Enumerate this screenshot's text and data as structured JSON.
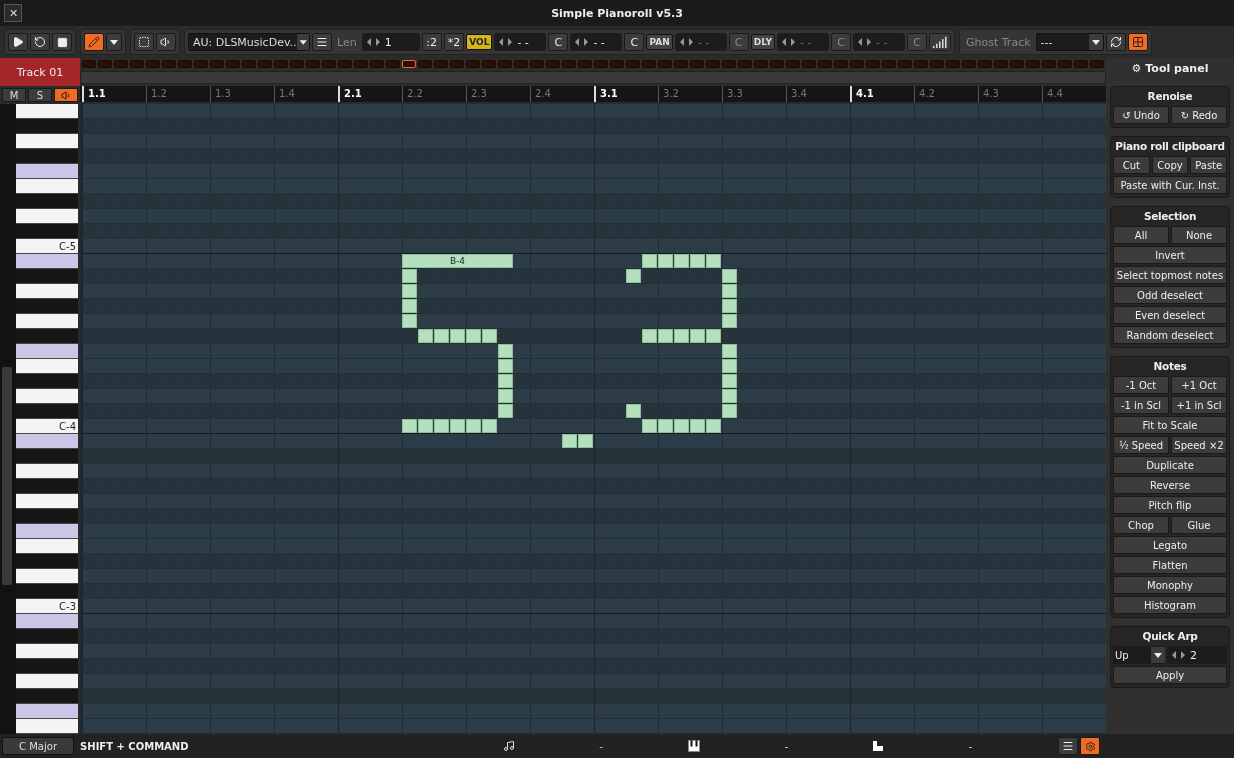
{
  "window": {
    "title": "Simple Pianoroll v5.3",
    "close": "✕"
  },
  "toolbar": {
    "edit_tools": [
      {
        "selected": true
      },
      {
        "selected": false
      }
    ],
    "preview": {
      "on": false
    },
    "instrument": {
      "value": "AU: DLSMusicDev.."
    },
    "length": {
      "label": "Len",
      "value": "1",
      "buttons": [
        ":2",
        "*2"
      ]
    },
    "params": [
      {
        "badge": "VOL",
        "active": true,
        "fields": [
          {
            "value": "- -",
            "reset": "C",
            "disabled": false
          },
          {
            "value": "- -",
            "reset": "C",
            "disabled": false
          }
        ]
      },
      {
        "badge": "PAN",
        "active": false,
        "fields": [
          {
            "value": "- -",
            "reset": "C",
            "disabled": true
          }
        ]
      },
      {
        "badge": "DLY",
        "active": false,
        "fields": [
          {
            "value": "- -",
            "reset": "C",
            "disabled": true
          },
          {
            "value": "- -",
            "reset": "C",
            "disabled": true
          }
        ]
      }
    ],
    "ghost_track": {
      "label": "Ghost Track",
      "value": "---"
    },
    "panel_toggle": {
      "on": true
    }
  },
  "track": {
    "name": "Track 01",
    "mute": "M",
    "solo": "S",
    "preview_on": true
  },
  "line_strip": [
    {
      "selected": false
    },
    {
      "selected": false
    },
    {
      "selected": false
    },
    {
      "selected": false
    },
    {
      "selected": false
    },
    {
      "selected": false
    },
    {
      "selected": false
    },
    {
      "selected": false
    },
    {
      "selected": false
    },
    {
      "selected": false
    },
    {
      "selected": false
    },
    {
      "selected": false
    },
    {
      "selected": false
    },
    {
      "selected": false
    },
    {
      "selected": false
    },
    {
      "selected": false
    },
    {
      "selected": false
    },
    {
      "selected": false
    },
    {
      "selected": false
    },
    {
      "selected": false
    },
    {
      "selected": true
    },
    {
      "selected": false
    },
    {
      "selected": false
    },
    {
      "selected": false
    },
    {
      "selected": false
    },
    {
      "selected": false
    },
    {
      "selected": false
    },
    {
      "selected": false
    },
    {
      "selected": false
    },
    {
      "selected": false
    },
    {
      "selected": false
    },
    {
      "selected": false
    },
    {
      "selected": false
    },
    {
      "selected": false
    },
    {
      "selected": false
    },
    {
      "selected": false
    },
    {
      "selected": false
    },
    {
      "selected": false
    },
    {
      "selected": false
    },
    {
      "selected": false
    },
    {
      "selected": false
    },
    {
      "selected": false
    },
    {
      "selected": false
    },
    {
      "selected": false
    },
    {
      "selected": false
    },
    {
      "selected": false
    },
    {
      "selected": false
    },
    {
      "selected": false
    },
    {
      "selected": false
    },
    {
      "selected": false
    },
    {
      "selected": false
    },
    {
      "selected": false
    },
    {
      "selected": false
    },
    {
      "selected": false
    },
    {
      "selected": false
    },
    {
      "selected": false
    },
    {
      "selected": false
    },
    {
      "selected": false
    },
    {
      "selected": false
    },
    {
      "selected": false
    },
    {
      "selected": false
    },
    {
      "selected": false
    },
    {
      "selected": false
    },
    {
      "selected": false
    }
  ],
  "ruler": [
    {
      "label": "1.1",
      "major": true
    },
    {
      "label": "1.2",
      "major": false
    },
    {
      "label": "1.3",
      "major": false
    },
    {
      "label": "1.4",
      "major": false
    },
    {
      "label": "2.1",
      "major": true
    },
    {
      "label": "2.2",
      "major": false
    },
    {
      "label": "2.3",
      "major": false
    },
    {
      "label": "2.4",
      "major": false
    },
    {
      "label": "3.1",
      "major": true
    },
    {
      "label": "3.2",
      "major": false
    },
    {
      "label": "3.3",
      "major": false
    },
    {
      "label": "3.4",
      "major": false
    },
    {
      "label": "4.1",
      "major": true
    },
    {
      "label": "4.2",
      "major": false
    },
    {
      "label": "4.3",
      "major": false
    },
    {
      "label": "4.4",
      "major": false
    }
  ],
  "keys": [
    {
      "kind": "white"
    },
    {
      "kind": "black"
    },
    {
      "kind": "white"
    },
    {
      "kind": "black"
    },
    {
      "kind": "tinted"
    },
    {
      "kind": "white"
    },
    {
      "kind": "black"
    },
    {
      "kind": "white"
    },
    {
      "kind": "black"
    },
    {
      "kind": "white",
      "label": "C-5"
    },
    {
      "kind": "tinted"
    },
    {
      "kind": "black"
    },
    {
      "kind": "white"
    },
    {
      "kind": "black"
    },
    {
      "kind": "white"
    },
    {
      "kind": "black"
    },
    {
      "kind": "tinted"
    },
    {
      "kind": "white"
    },
    {
      "kind": "black"
    },
    {
      "kind": "white"
    },
    {
      "kind": "black"
    },
    {
      "kind": "white",
      "label": "C-4"
    },
    {
      "kind": "tinted"
    },
    {
      "kind": "black"
    },
    {
      "kind": "white"
    },
    {
      "kind": "black"
    },
    {
      "kind": "white"
    },
    {
      "kind": "black"
    },
    {
      "kind": "tinted"
    },
    {
      "kind": "white"
    },
    {
      "kind": "black"
    },
    {
      "kind": "white"
    },
    {
      "kind": "black"
    },
    {
      "kind": "white",
      "label": "C-3"
    },
    {
      "kind": "tinted"
    },
    {
      "kind": "black"
    },
    {
      "kind": "white"
    },
    {
      "kind": "black"
    },
    {
      "kind": "white"
    },
    {
      "kind": "black"
    },
    {
      "kind": "tinted"
    },
    {
      "kind": "white"
    }
  ],
  "note_label": "B-4",
  "tool_panel": {
    "title_icon": "⚙",
    "title": "Tool panel",
    "sections": [
      {
        "title": "Renoise",
        "rows": [
          [
            {
              "kind": "button",
              "label": "↺ Undo"
            },
            {
              "kind": "button",
              "label": "↻ Redo"
            }
          ]
        ]
      },
      {
        "title": "Piano roll clipboard",
        "rows": [
          [
            {
              "kind": "button",
              "label": "Cut"
            },
            {
              "kind": "button",
              "label": "Copy"
            },
            {
              "kind": "button",
              "label": "Paste"
            }
          ],
          [
            {
              "kind": "button",
              "label": "Paste with Cur. Inst."
            }
          ]
        ]
      },
      {
        "title": "Selection",
        "rows": [
          [
            {
              "kind": "button",
              "label": "All"
            },
            {
              "kind": "button",
              "label": "None"
            }
          ],
          [
            {
              "kind": "button",
              "label": "Invert"
            }
          ],
          [
            {
              "kind": "button",
              "label": "Select topmost notes"
            }
          ],
          [
            {
              "kind": "button",
              "label": "Odd deselect"
            }
          ],
          [
            {
              "kind": "button",
              "label": "Even deselect"
            }
          ],
          [
            {
              "kind": "button",
              "label": "Random deselect"
            }
          ]
        ]
      },
      {
        "title": "Notes",
        "rows": [
          [
            {
              "kind": "button",
              "label": "-1 Oct"
            },
            {
              "kind": "button",
              "label": "+1 Oct"
            }
          ],
          [
            {
              "kind": "button",
              "label": "-1 in Scl"
            },
            {
              "kind": "button",
              "label": "+1 in Scl"
            }
          ],
          [
            {
              "kind": "button",
              "label": "Fit to Scale"
            }
          ],
          [
            {
              "kind": "button",
              "label": "½ Speed"
            },
            {
              "kind": "button",
              "label": "Speed ×2"
            }
          ],
          [
            {
              "kind": "button",
              "label": "Duplicate"
            }
          ],
          [
            {
              "kind": "button",
              "label": "Reverse"
            }
          ],
          [
            {
              "kind": "button",
              "label": "Pitch flip"
            }
          ],
          [
            {
              "kind": "button",
              "label": "Chop"
            },
            {
              "kind": "button",
              "label": "Glue"
            }
          ],
          [
            {
              "kind": "button",
              "label": "Legato"
            }
          ],
          [
            {
              "kind": "button",
              "label": "Flatten"
            }
          ],
          [
            {
              "kind": "button",
              "label": "Monophy"
            }
          ],
          [
            {
              "kind": "button",
              "label": "Histogram"
            }
          ]
        ]
      },
      {
        "title": "Quick Arp",
        "rows": [
          [
            {
              "kind": "dropdown",
              "label": "Up"
            },
            {
              "kind": "valuebox",
              "label": "2"
            }
          ],
          [
            {
              "kind": "button",
              "label": "Apply"
            }
          ]
        ]
      }
    ]
  },
  "status_bar": {
    "scale": "C Major",
    "hint": "SHIFT + COMMAND",
    "readouts": [
      {
        "value": "-"
      },
      {
        "value": "-"
      },
      {
        "value": "-"
      }
    ],
    "buttons": [
      {
        "on": false
      },
      {
        "on": true
      }
    ]
  }
}
